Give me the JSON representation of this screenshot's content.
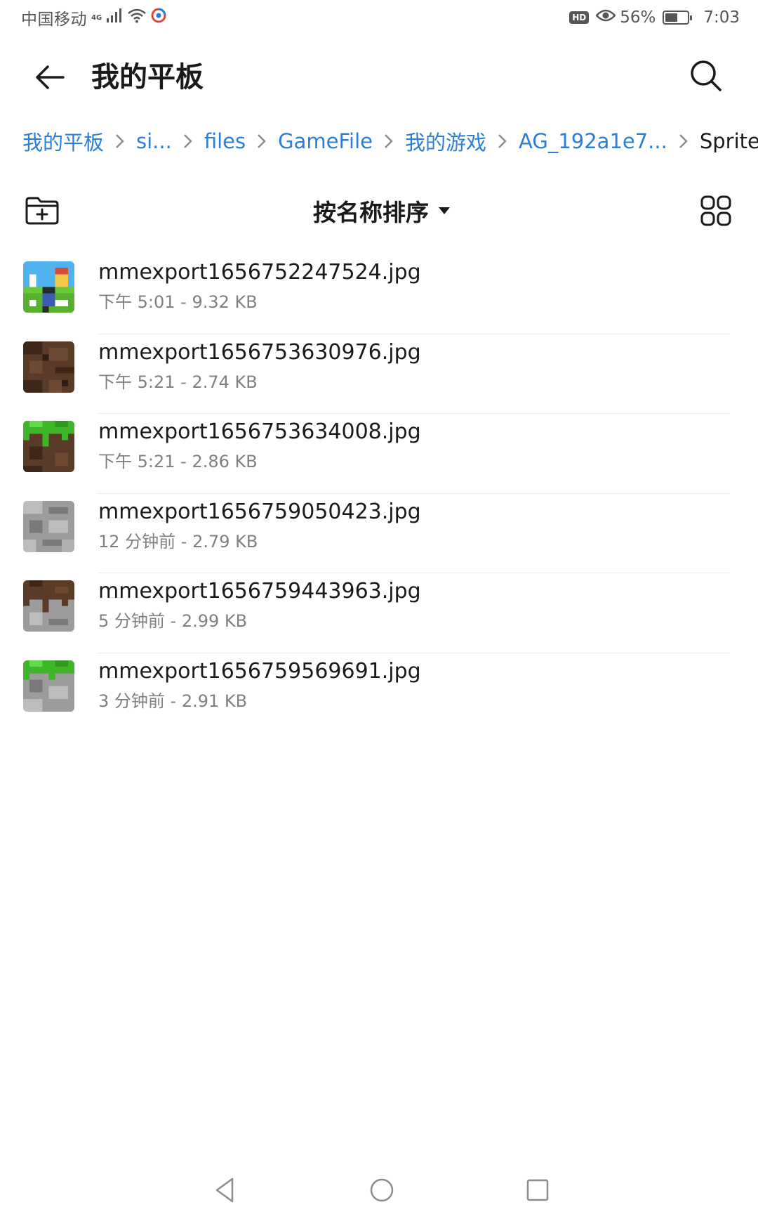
{
  "status_bar": {
    "carrier": "中国移动",
    "network": "4G",
    "hd_badge": "HD",
    "battery_percent": "56%",
    "battery_level": 0.56,
    "time": "7:03"
  },
  "header": {
    "title": "我的平板",
    "back_icon": "arrow-left-icon",
    "search_icon": "search-icon"
  },
  "breadcrumb": [
    {
      "label": "我的平板"
    },
    {
      "label": "si..."
    },
    {
      "label": "files"
    },
    {
      "label": "GameFile"
    },
    {
      "label": "我的游戏"
    },
    {
      "label": "AG_192a1e7..."
    },
    {
      "label": "Sprite"
    }
  ],
  "toolbar": {
    "sort_label": "按名称排序",
    "new_folder_icon": "new-folder-icon",
    "grid_view_icon": "grid-view-icon"
  },
  "files": [
    {
      "name": "mmexport1656752247524.jpg",
      "meta": "下午 5:01  - 9.32 KB",
      "thumb": "character-scene"
    },
    {
      "name": "mmexport1656753630976.jpg",
      "meta": "下午 5:21  - 2.74 KB",
      "thumb": "dirt-block"
    },
    {
      "name": "mmexport1656753634008.jpg",
      "meta": "下午 5:21  - 2.86 KB",
      "thumb": "grass-dirt-block"
    },
    {
      "name": "mmexport1656759050423.jpg",
      "meta": "12 分钟前 - 2.79 KB",
      "thumb": "stone-block"
    },
    {
      "name": "mmexport1656759443963.jpg",
      "meta": "5 分钟前 - 2.99 KB",
      "thumb": "dirt-stone-block"
    },
    {
      "name": "mmexport1656759569691.jpg",
      "meta": "3 分钟前 - 2.91 KB",
      "thumb": "grass-stone-block"
    }
  ],
  "colors": {
    "accent": "#2c7fd6",
    "text_primary": "#1a1a1a",
    "text_secondary": "#808080"
  }
}
